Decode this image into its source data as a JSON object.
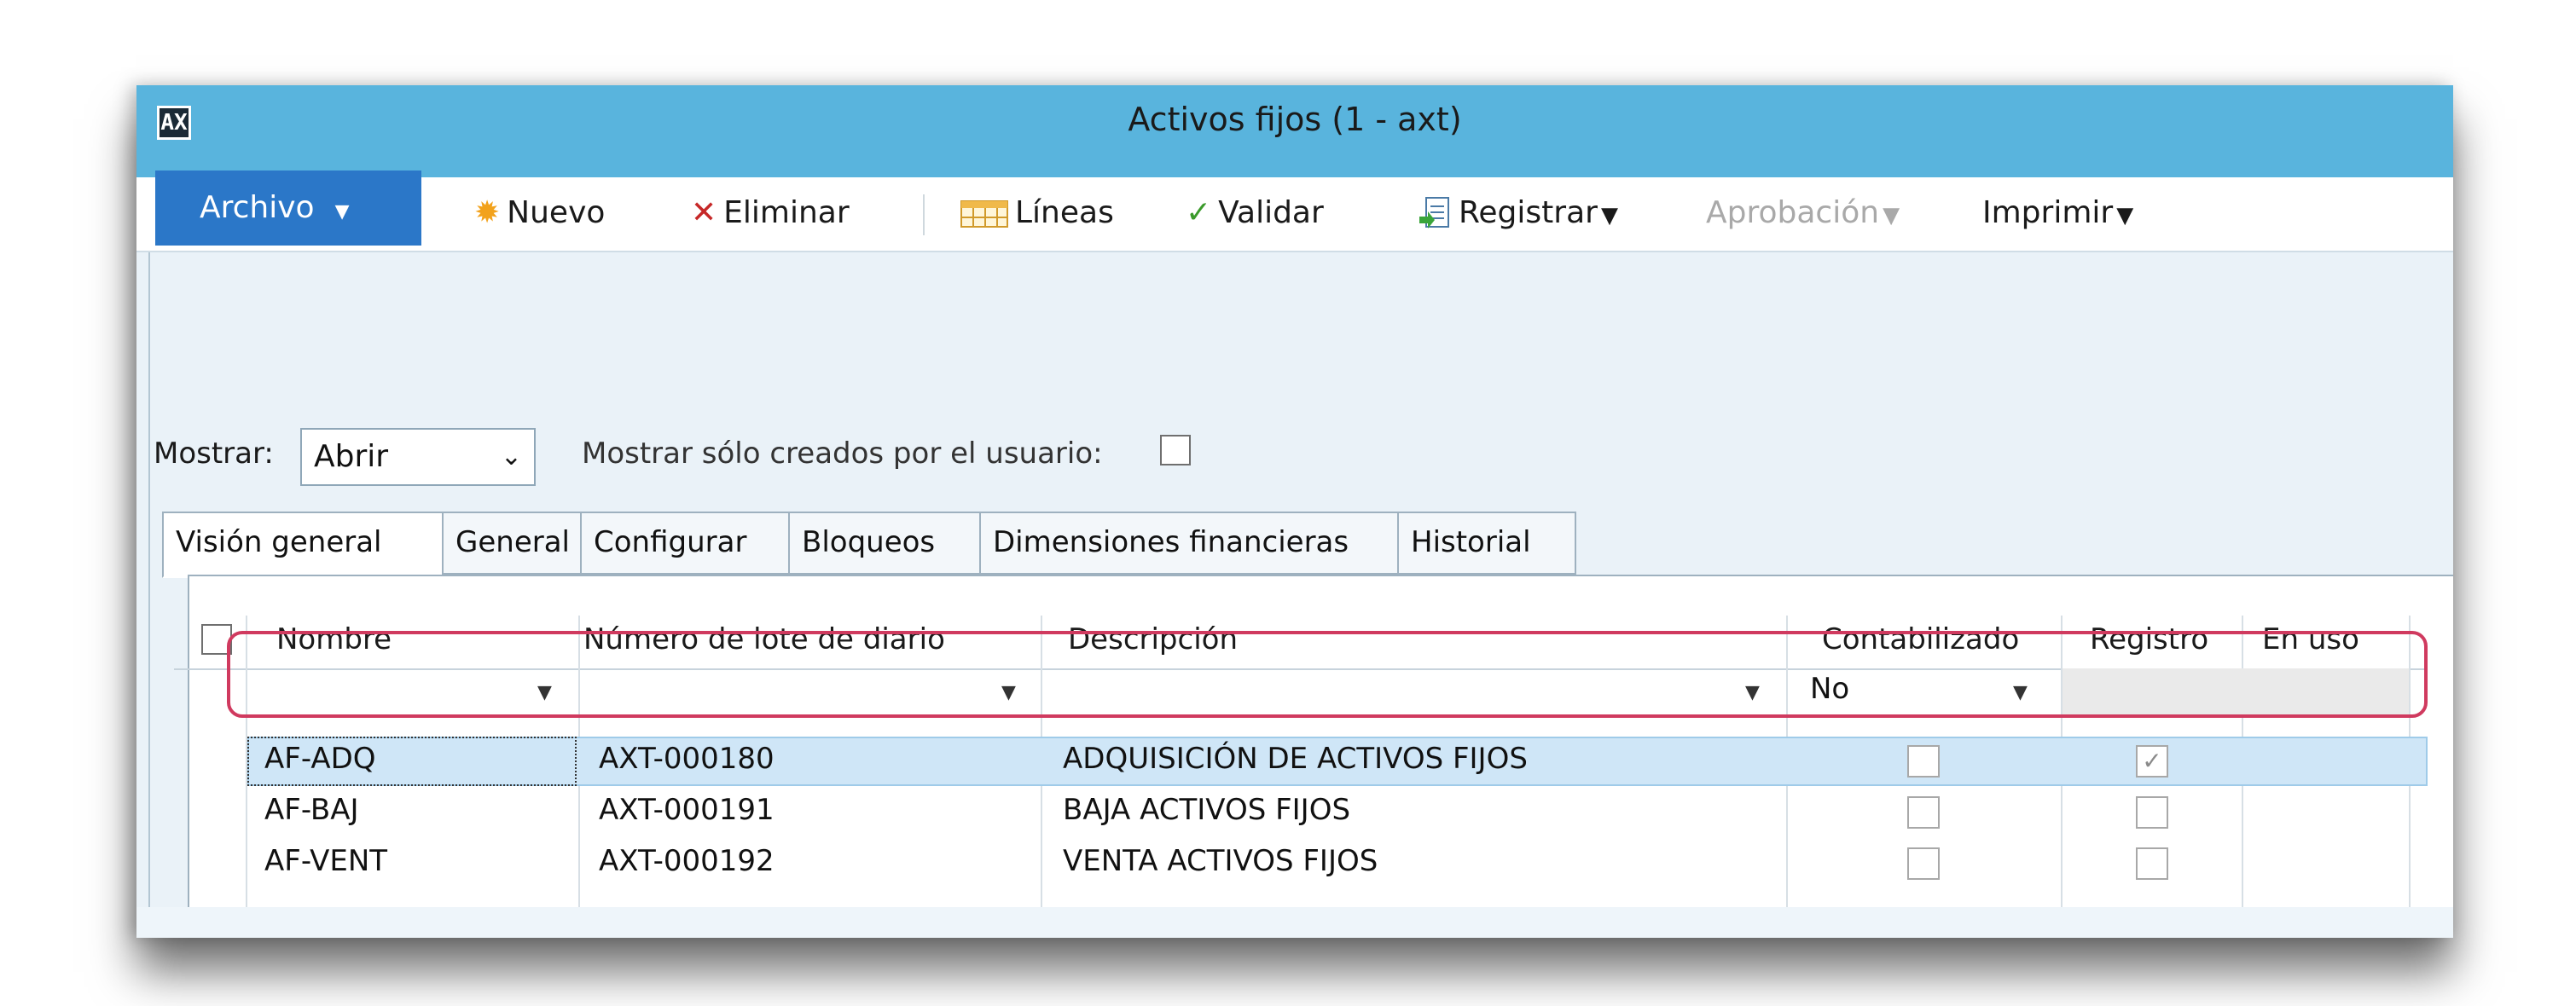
{
  "window": {
    "title": "Activos fijos (1 - axt)",
    "app_icon_glyph": "AX"
  },
  "ribbon": {
    "archivo_label": "Archivo",
    "nuevo_label": "Nuevo",
    "eliminar_label": "Eliminar",
    "lineas_label": "Líneas",
    "validar_label": "Validar",
    "registrar_label": "Registrar",
    "aprobacion_label": "Aprobación",
    "imprimir_label": "Imprimir",
    "dropdown_caret": "▼"
  },
  "filter": {
    "mostrar_label": "Mostrar:",
    "mostrar_value": "Abrir",
    "user_label": "Mostrar sólo creados por el usuario:"
  },
  "tabs": [
    "Visión general",
    "General",
    "Configurar",
    "Bloqueos",
    "Dimensiones financieras",
    "Historial"
  ],
  "grid": {
    "columns": [
      "Nombre",
      "Número de lote de diario",
      "Descripción",
      "Contabilizado",
      "Registro",
      "En uso"
    ],
    "contabilizado_filter": "No",
    "rows": [
      {
        "nombre": "AF-ADQ",
        "lote": "AXT-000180",
        "descripcion": "ADQUISICIÓN DE ACTIVOS FIJOS",
        "contabilizado": false,
        "registro": true
      },
      {
        "nombre": "AF-BAJ",
        "lote": "AXT-000191",
        "descripcion": "BAJA ACTIVOS FIJOS",
        "contabilizado": false,
        "registro": false
      },
      {
        "nombre": "AF-VENT",
        "lote": "AXT-000192",
        "descripcion": "VENTA ACTIVOS FIJOS",
        "contabilizado": false,
        "registro": false
      }
    ],
    "check_glyph": "✓"
  },
  "colors": {
    "titlebar": "#59b4dd",
    "archivo": "#2b77c8",
    "highlight": "#d03a5f",
    "selected_row": "#cfe6f7"
  },
  "icons": {
    "nuevo": "sun-icon",
    "eliminar": "x-icon",
    "lineas": "calendar-grid-icon",
    "validar": "check-icon",
    "registrar": "post-document-icon"
  }
}
